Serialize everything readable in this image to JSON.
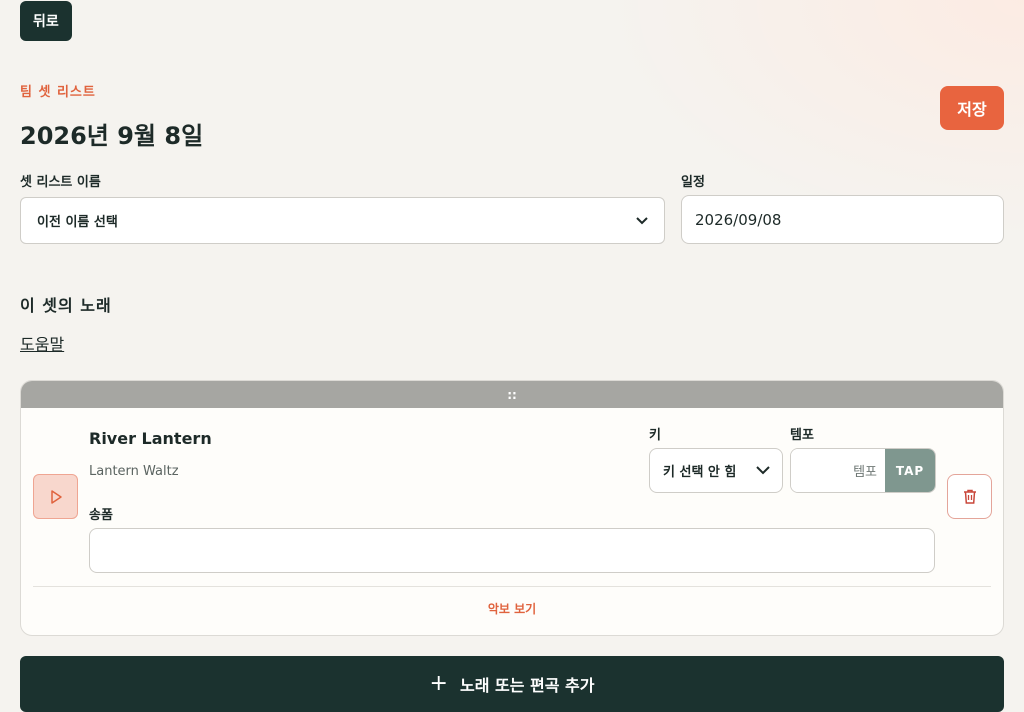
{
  "header": {
    "back_label": "뒤로",
    "eyebrow": "팀 셋 리스트",
    "title": "2026년 9월 8일",
    "save_label": "저장"
  },
  "form": {
    "name_label": "셋 리스트 이름",
    "name_selected": "이전 이름 선택",
    "date_label": "일정",
    "date_value": "2026/09/08"
  },
  "songs_section": {
    "title": "이 셋의 노래",
    "help_link": "도움말",
    "items": [
      {
        "drag_handle": "::",
        "title": "River Lantern",
        "subtitle": "Lantern Waltz",
        "key_label": "키",
        "key_selected": "키 선택 안 힘",
        "tempo_label": "템포",
        "tempo_placeholder": "템포",
        "tap_label": "TAP",
        "transpose_label": "송폼",
        "transpose_value": "",
        "sheet_link": "악보 보기"
      }
    ]
  },
  "add_button": {
    "icon": "+",
    "label": "노래 또는 편곡 추가"
  },
  "colors": {
    "accent": "#e8643f",
    "dark": "#1b322f",
    "tap": "#7f978f",
    "background": "#f5f3ef"
  },
  "icons": {
    "play": "play-icon",
    "delete": "trash-icon",
    "chevron": "chevron-down-icon",
    "add": "plus-icon"
  }
}
